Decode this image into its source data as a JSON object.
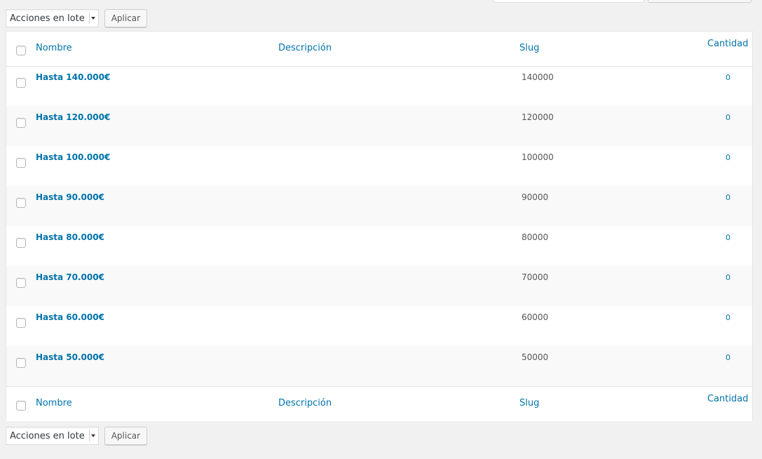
{
  "bulk_actions": {
    "select_value": "Acciones en lote",
    "apply_label": "Aplicar"
  },
  "table": {
    "columns": {
      "name": "Nombre",
      "description": "Descripción",
      "slug": "Slug",
      "count": "Cantidad"
    },
    "rows": [
      {
        "name": "Hasta 140.000€",
        "description": "",
        "slug": "140000",
        "count": "0"
      },
      {
        "name": "Hasta 120.000€",
        "description": "",
        "slug": "120000",
        "count": "0"
      },
      {
        "name": "Hasta 100.000€",
        "description": "",
        "slug": "100000",
        "count": "0"
      },
      {
        "name": "Hasta 90.000€",
        "description": "",
        "slug": "90000",
        "count": "0"
      },
      {
        "name": "Hasta 80.000€",
        "description": "",
        "slug": "80000",
        "count": "0"
      },
      {
        "name": "Hasta 70.000€",
        "description": "",
        "slug": "70000",
        "count": "0"
      },
      {
        "name": "Hasta 60.000€",
        "description": "",
        "slug": "60000",
        "count": "0"
      },
      {
        "name": "Hasta 50.000€",
        "description": "",
        "slug": "50000",
        "count": "0"
      }
    ]
  },
  "colors": {
    "link": "#0073aa",
    "row_alt": "#f9f9f9",
    "background": "#f1f1f1"
  }
}
